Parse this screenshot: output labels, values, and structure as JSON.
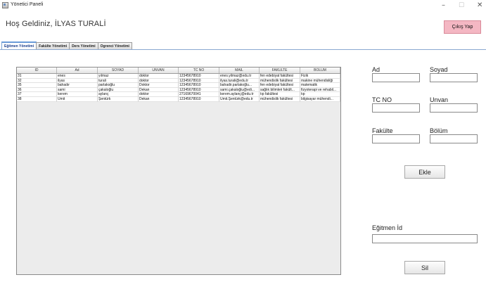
{
  "window": {
    "title": "Yönetici Paneli"
  },
  "header": {
    "welcome": "Hoş Geldiniz, İLYAS TURALİ",
    "logout_label": "Çıkış Yap"
  },
  "tabs": [
    {
      "label": "Eğitmen Yönetimi",
      "active": true
    },
    {
      "label": "Fakülte Yönetimi",
      "active": false
    },
    {
      "label": "Ders Yönetimi",
      "active": false
    },
    {
      "label": "Ogrenci Yönetimi",
      "active": false
    }
  ],
  "table": {
    "columns": [
      "ID",
      "Ad",
      "SOYAD",
      "UNVAN",
      "TC NO",
      "MAIL",
      "FAKULTE",
      "BOLUM"
    ],
    "rows": [
      [
        "31",
        "enes",
        "yılmaz",
        "doktor",
        "12345678910",
        "enes.yilmaz@edu.tr",
        "fen edebiyat fakültesi",
        "Fizik"
      ],
      [
        "32",
        "ilyas",
        "turali",
        "doktor",
        "12345678910",
        "ilyas.turali@edu.tr",
        "mühendislik fakültesi",
        "makine mühendisliği"
      ],
      [
        "35",
        "bahadır",
        "parlakoğlu",
        "Doktor",
        "12345678910",
        "bahadir.parlakoğlu...",
        "fen edebiyat fakültesi",
        "matematik"
      ],
      [
        "36",
        "sami",
        "çakaloğlu",
        "Dekan",
        "12345678910",
        "sami.çakaloğlu@edi...",
        "sağlık bilimleri fakült...",
        "fizyoterapi ve rehabil..."
      ],
      [
        "37",
        "kerem",
        "aylanç",
        "doktor",
        "27169670041",
        "kerem.aylanç@edu.tr",
        "tıp fakültesi",
        "tıp"
      ],
      [
        "38",
        "Ümit",
        "Şentürk",
        "Dekan",
        "12345678910",
        "Ümit.Şentürk@edu.tr",
        "mühendislik fakültesi",
        "bilgisayar mühendi..."
      ]
    ]
  },
  "form": {
    "ad_label": "Ad",
    "soyad_label": "Soyad",
    "tc_label": "TC NO",
    "unvan_label": "Unvan",
    "fakulte_label": "Fakülte",
    "bolum_label": "Bölüm",
    "add_label": "Ekle",
    "id_label": "Eğitmen İd",
    "delete_label": "Sil"
  },
  "colors": {
    "logout_bg": "#f4b7c3",
    "tab_active_border": "#6a9bd8",
    "table_bg": "#ececec"
  }
}
